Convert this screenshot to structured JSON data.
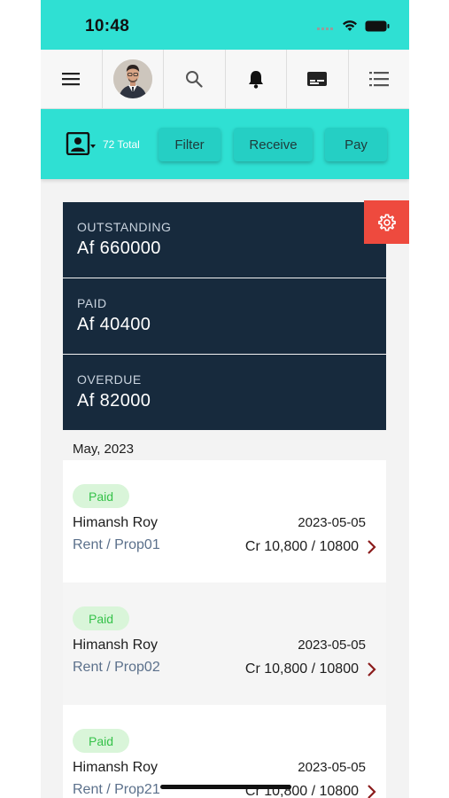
{
  "status_bar": {
    "time": "10:48"
  },
  "nav": {
    "items": [
      "menu-icon",
      "avatar",
      "search-icon",
      "bell-icon",
      "card-icon",
      "list-icon"
    ]
  },
  "actions": {
    "total": "72 Total",
    "filter_label": "Filter",
    "receive_label": "Receive",
    "pay_label": "Pay"
  },
  "summary": [
    {
      "label": "OUTSTANDING",
      "value": "Af 660000"
    },
    {
      "label": "PAID",
      "value": "Af 40400"
    },
    {
      "label": "OVERDUE",
      "value": "Af 82000"
    }
  ],
  "month": "May, 2023",
  "transactions": [
    {
      "status": "Paid",
      "name": "Himansh Roy",
      "sub": "Rent / Prop01",
      "date": "2023-05-05",
      "amount": "Cr 10,800 / 10800"
    },
    {
      "status": "Paid",
      "name": "Himansh Roy",
      "sub": "Rent / Prop02",
      "date": "2023-05-05",
      "amount": "Cr 10,800 / 10800"
    },
    {
      "status": "Paid",
      "name": "Himansh Roy",
      "sub": "Rent / Prop21",
      "date": "2023-05-05",
      "amount": "Cr 10,800 / 10800"
    }
  ],
  "colors": {
    "accent": "#2fe0d3",
    "summary_bg": "#172a3d",
    "settings": "#ee4a3e",
    "paid_badge_bg": "#d9f5d9",
    "paid_badge_text": "#36c24a",
    "chevron": "#8b1c1c"
  }
}
